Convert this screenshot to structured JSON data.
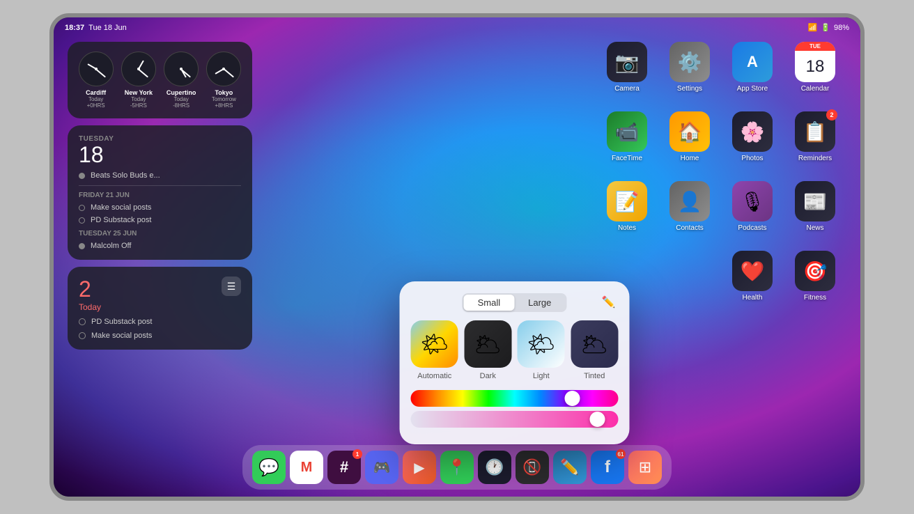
{
  "status": {
    "time": "18:37",
    "date": "Tue 18 Jun",
    "battery": "98%",
    "wifi": "WiFi",
    "battery_icon": "🔋"
  },
  "clocks": [
    {
      "city": "Cardiff",
      "day": "Today",
      "offset": "+0HRS",
      "hour_angle": -60,
      "min_angle": 130
    },
    {
      "city": "New York",
      "day": "Today",
      "offset": "-5HRS",
      "hour_angle": 30,
      "min_angle": 130
    },
    {
      "city": "Cupertino",
      "day": "Today",
      "offset": "-8HRS",
      "hour_angle": 150,
      "min_angle": 130
    },
    {
      "city": "Tokyo",
      "day": "Tomorrow",
      "offset": "+8HRS",
      "hour_angle": -120,
      "min_angle": 130
    }
  ],
  "reminder_widget": {
    "day_label": "TUESDAY",
    "date": "18",
    "items": [
      {
        "text": "Beats Solo Buds e...",
        "filled": true
      }
    ],
    "section2_label": "FRIDAY 21 JUN",
    "items2": [
      {
        "text": "Make social posts"
      },
      {
        "text": "PD Substack post"
      }
    ],
    "section3_label": "TUESDAY 25 JUN",
    "items3": [
      {
        "text": "Malcolm Off",
        "filled": true
      }
    ]
  },
  "reminders_widget": {
    "count": "2",
    "today_label": "Today",
    "items": [
      {
        "text": "PD Substack post"
      },
      {
        "text": "Make social posts"
      }
    ]
  },
  "apps": [
    {
      "id": "camera",
      "label": "Camera",
      "icon": "📷",
      "bg": "bg-camera"
    },
    {
      "id": "settings",
      "label": "Settings",
      "icon": "⚙️",
      "bg": "bg-settings"
    },
    {
      "id": "appstore",
      "label": "App Store",
      "icon": "🅰",
      "bg": "bg-appstore"
    },
    {
      "id": "calendar",
      "label": "Calendar",
      "icon": "cal",
      "bg": "bg-calendar"
    },
    {
      "id": "facetime",
      "label": "FaceTime",
      "icon": "📹",
      "bg": "bg-facetime"
    },
    {
      "id": "home",
      "label": "Home",
      "icon": "🏠",
      "bg": "bg-home"
    },
    {
      "id": "photos",
      "label": "Photos",
      "icon": "🌸",
      "bg": "bg-photos"
    },
    {
      "id": "reminders",
      "label": "Reminders",
      "icon": "☰",
      "bg": "bg-reminders",
      "badge": "2"
    },
    {
      "id": "notes",
      "label": "Notes",
      "icon": "📝",
      "bg": "bg-notes"
    },
    {
      "id": "contacts",
      "label": "Contacts",
      "icon": "👤",
      "bg": "bg-contacts"
    },
    {
      "id": "podcasts",
      "label": "Podcasts",
      "icon": "🎙",
      "bg": "bg-podcasts"
    },
    {
      "id": "news",
      "label": "News",
      "icon": "📰",
      "bg": "bg-news"
    },
    {
      "id": "health",
      "label": "Health",
      "icon": "❤️",
      "bg": "bg-health"
    },
    {
      "id": "fitness",
      "label": "Fitness",
      "icon": "🎯",
      "bg": "bg-fitness"
    }
  ],
  "dock": [
    {
      "id": "messages",
      "icon": "💬",
      "bg": "dock-messages"
    },
    {
      "id": "gmail",
      "icon": "✉",
      "bg": "dock-gmail"
    },
    {
      "id": "slack",
      "icon": "#",
      "bg": "dock-slack",
      "badge": "1"
    },
    {
      "id": "discord",
      "icon": "⚙",
      "bg": "dock-discord"
    },
    {
      "id": "altstore",
      "icon": "▶",
      "bg": "dock-altstore"
    },
    {
      "id": "maps",
      "icon": "📍",
      "bg": "dock-maps"
    },
    {
      "id": "screentime",
      "icon": "⏱",
      "bg": "dock-clock2"
    },
    {
      "id": "pixelmator",
      "icon": "✏",
      "bg": "dock-pixelmator"
    },
    {
      "id": "facebook",
      "icon": "f",
      "bg": "dock-facebook",
      "badge": "61"
    },
    {
      "id": "launchpad",
      "icon": "⊞",
      "bg": "dock-launchpad"
    }
  ],
  "widget_picker": {
    "seg_small": "Small",
    "seg_large": "Large",
    "options": [
      {
        "id": "automatic",
        "label": "Automatic",
        "style": "weather-auto"
      },
      {
        "id": "dark",
        "label": "Dark",
        "style": "weather-dark"
      },
      {
        "id": "light",
        "label": "Light",
        "style": "weather-light"
      },
      {
        "id": "tinted",
        "label": "Tinted",
        "style": "weather-tinted"
      }
    ],
    "rainbow_thumb_pct": 78,
    "pink_thumb_pct": 90
  }
}
